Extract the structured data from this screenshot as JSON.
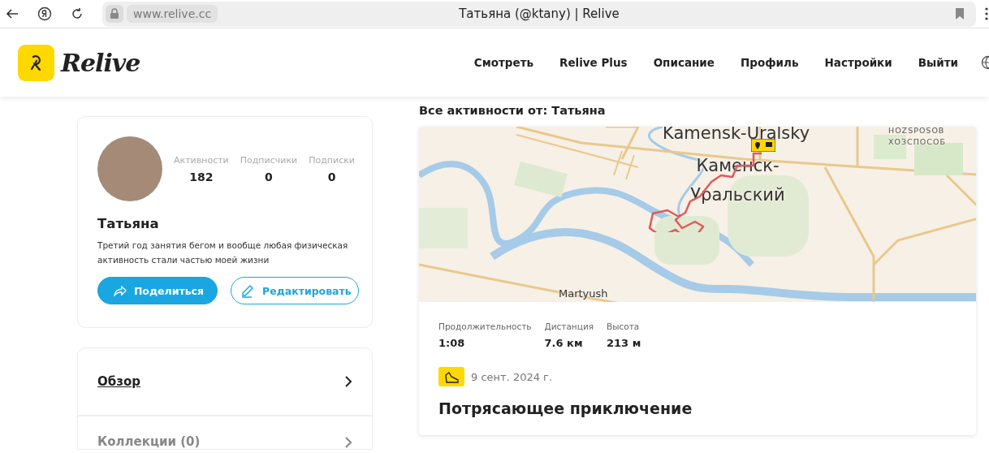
{
  "browser": {
    "url": "www.relive.cc",
    "title": "Татьяна (@ktany) | Relive"
  },
  "header": {
    "logo_text": "Relive",
    "nav": [
      "Смотреть",
      "Relive Plus",
      "Описание",
      "Профиль",
      "Настройки",
      "Выйти"
    ]
  },
  "profile": {
    "stats": [
      {
        "label": "Активности",
        "value": "182"
      },
      {
        "label": "Подписчики",
        "value": "0"
      },
      {
        "label": "Подписки",
        "value": "0"
      }
    ],
    "name": "Татьяна",
    "bio": "Третий год занятия бегом и вообще любая физическая активность стали частью моей жизни",
    "buttons": [
      {
        "kind": "share",
        "label": "Поделиться"
      },
      {
        "kind": "edit",
        "label": "Редактировать"
      }
    ]
  },
  "menu": [
    {
      "label": "Обзор",
      "selected": true
    },
    {
      "label": "Коллекции (0)",
      "selected": false
    }
  ],
  "feed": {
    "heading": "Все активности от: Татьяна",
    "activity": {
      "map_labels": [
        {
          "kind": "city_en",
          "text": "Kamensk-Uralsky"
        },
        {
          "kind": "city_ru",
          "text": "Каменск-Уральский"
        },
        {
          "kind": "district_en",
          "text": "HOZSPOSOB"
        },
        {
          "kind": "district_ru",
          "text": "ХОЗСПОСОБ"
        },
        {
          "kind": "village",
          "text": "Martyush"
        }
      ],
      "stats": [
        {
          "label": "Продолжительность",
          "value": "1:08"
        },
        {
          "label": "Дистанция",
          "value": "7.6 км"
        },
        {
          "label": "Высота",
          "value": "213 м"
        }
      ],
      "date": "9 сент. 2024 г.",
      "title": "Потрясающее приключение"
    }
  }
}
